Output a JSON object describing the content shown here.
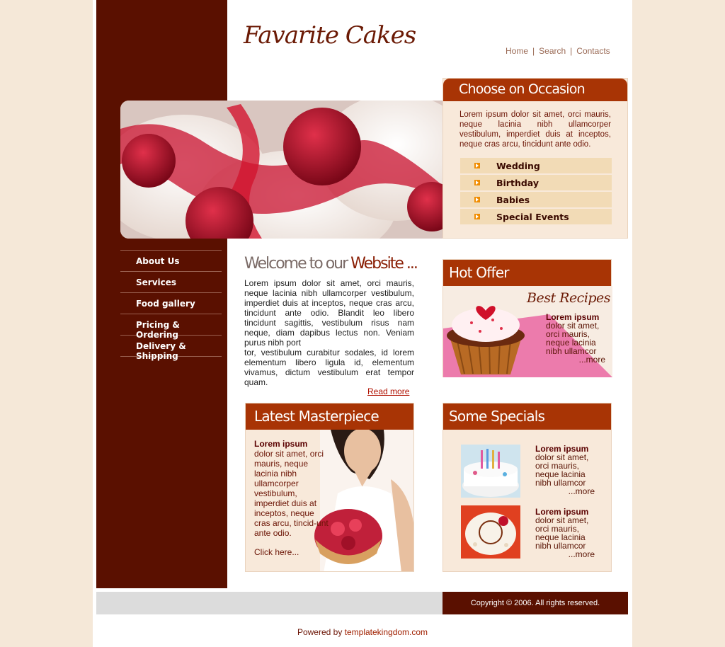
{
  "site": {
    "logo": "Favarite Cakes"
  },
  "topnav": {
    "home": "Home",
    "search": "Search",
    "contacts": "Contacts",
    "separator": "|"
  },
  "occasion": {
    "title": "Choose on Occasion",
    "text": "Lorem ipsum dolor sit amet, orci mauris, neque lacinia nibh ullamcorper vestibulum, imperdiet duis at inceptos, neque cras arcu, tincidunt ante odio.",
    "items": [
      {
        "label": "Wedding"
      },
      {
        "label": "Birthday"
      },
      {
        "label": "Babies"
      },
      {
        "label": "Special Events"
      }
    ]
  },
  "sidenav": {
    "items": [
      {
        "label": "About Us"
      },
      {
        "label": "Services"
      },
      {
        "label": "Food gallery"
      },
      {
        "label": "Pricing & Ordering"
      },
      {
        "label": "Delivery & Shipping"
      }
    ]
  },
  "welcome": {
    "title_plain": "Welcome to our ",
    "title_accent": "Website ...",
    "body_1": "Lorem ipsum dolor sit amet, orci mauris, neque lacinia nibh ullamcorper vestibulum, imperdiet duis at inceptos, neque cras arcu, tincidunt ante odio. Blandit leo libero tincidunt sagittis, vestibulum risus nam neque, diam dapibus lectus non. Veniam purus nibh port",
    "body_2": "tor, vestibulum curabitur sodales, id lorem elementum libero ligula id, elementum vivamus, dictum vestibulum erat tempor quam.",
    "read_more": "Read more"
  },
  "hot_offer": {
    "title": "Hot Offer",
    "script": "Best Recipes",
    "lorem_title": "Lorem ipsum",
    "text": "dolor sit amet, orci mauris, neque lacinia nibh ullamcor",
    "more": "...more"
  },
  "latest": {
    "title": "Latest Masterpiece",
    "lorem_title": "Lorem ipsum",
    "text": "dolor sit amet, orci mauris, neque lacinia nibh ullamcorper vestibulum, imperdiet duis at inceptos, neque cras arcu, tincid-unt ante odio.",
    "click": "Click here..."
  },
  "specials": {
    "title": "Some Specials",
    "items": [
      {
        "lorem_title": "Lorem ipsum",
        "text": "dolor sit amet, orci mauris, neque lacinia nibh ullamcor",
        "more": "...more"
      },
      {
        "lorem_title": "Lorem ipsum",
        "text": "dolor sit amet, orci mauris, neque lacinia nibh ullamcor",
        "more": "...more"
      }
    ]
  },
  "footer": {
    "copyright": "Copyright © 2006. All rights reserved.",
    "powered_prefix": "Powered by ",
    "powered_link": "templatekingdom.com"
  },
  "colors": {
    "brown": "#5a1000",
    "accent": "#a83405",
    "cream": "#f8e9da",
    "background": "#f5e8d8"
  }
}
